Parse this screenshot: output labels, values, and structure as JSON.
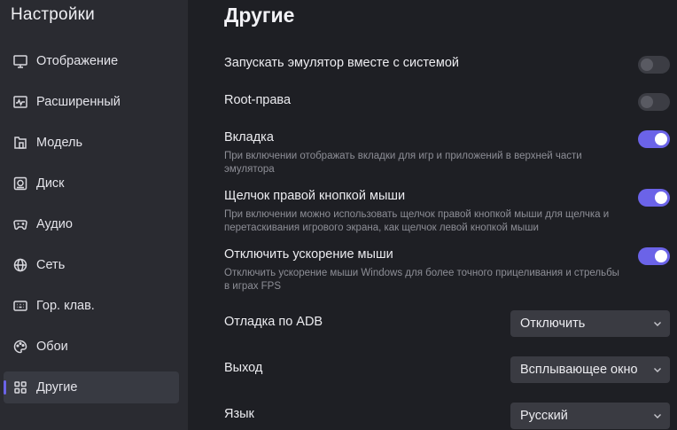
{
  "sidebar": {
    "title": "Настройки",
    "items": [
      {
        "label": "Отображение",
        "icon": "monitor-icon"
      },
      {
        "label": "Расширенный",
        "icon": "activity-icon"
      },
      {
        "label": "Модель",
        "icon": "folder-icon"
      },
      {
        "label": "Диск",
        "icon": "disk-icon"
      },
      {
        "label": "Аудио",
        "icon": "gamepad-icon"
      },
      {
        "label": "Сеть",
        "icon": "globe-icon"
      },
      {
        "label": "Гор. клав.",
        "icon": "keyboard-icon"
      },
      {
        "label": "Обои",
        "icon": "palette-icon"
      },
      {
        "label": "Другие",
        "icon": "grid-icon",
        "active": true
      }
    ]
  },
  "main": {
    "title": "Другие",
    "settings": [
      {
        "label": "Запускать эмулятор вместе с системой",
        "type": "toggle",
        "on": false
      },
      {
        "label": "Root-права",
        "type": "toggle",
        "on": false
      },
      {
        "label": "Вкладка",
        "type": "toggle",
        "on": true,
        "desc": "При включении отображать вкладки для игр и приложений в верхней части эмулятора"
      },
      {
        "label": "Щелчок правой кнопкой мыши",
        "type": "toggle",
        "on": true,
        "desc": "При включении можно использовать щелчок правой кнопкой мыши для щелчка и перетаскивания игрового экрана, как щелчок левой кнопкой мыши"
      },
      {
        "label": "Отключить ускорение мыши",
        "type": "toggle",
        "on": true,
        "desc": "Отключить ускорение мыши Windows для более точного прицеливания и стрельбы в играх FPS"
      },
      {
        "label": "Отладка по ADB",
        "type": "select",
        "value": "Отключить"
      },
      {
        "label": "Выход",
        "type": "select",
        "value": "Всплывающее окно"
      },
      {
        "label": "Язык",
        "type": "select",
        "value": "Русский"
      }
    ]
  },
  "colors": {
    "accent": "#6b63e8",
    "sidebar_bg": "#2a2b31",
    "main_bg": "#1e1f24"
  }
}
